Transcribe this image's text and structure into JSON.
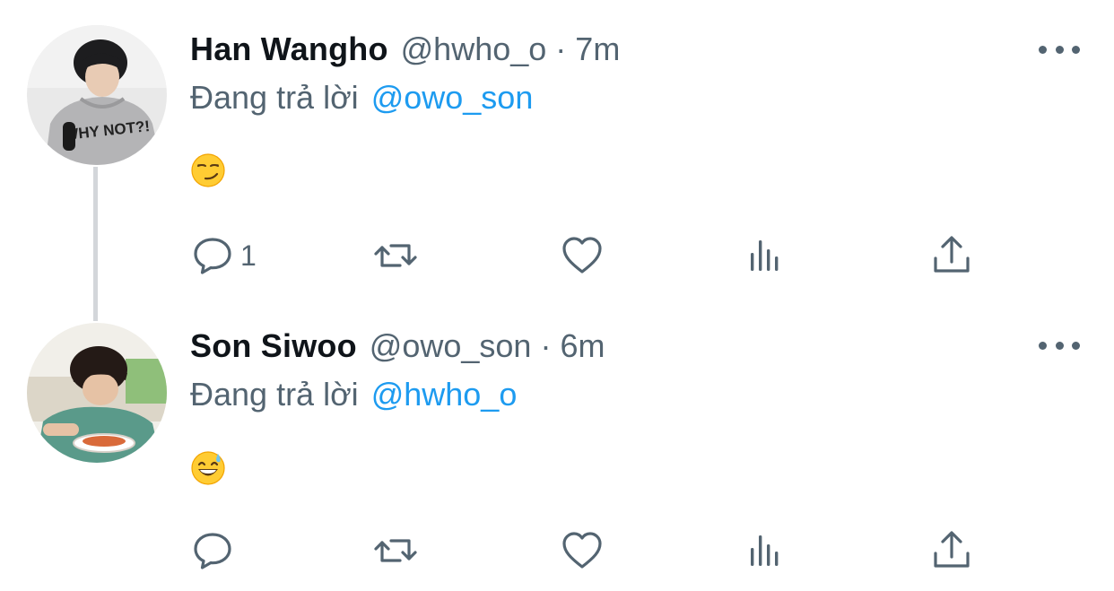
{
  "colors": {
    "name": "#0f1419",
    "secondary": "#536471",
    "mention": "#1d9bf0",
    "thread_line": "#d3d6da"
  },
  "tweets": [
    {
      "name": "Han Wangho",
      "handle": "@hwho_o",
      "separator": "·",
      "time": "7m",
      "reply_prefix": "Đang trả lời",
      "reply_to": "@owo_son",
      "emoji": "smirking-face",
      "avatar": "profile photo",
      "actions": {
        "reply_count": "1",
        "retweet_count": "",
        "like_count": ""
      }
    },
    {
      "name": "Son Siwoo",
      "handle": "@owo_son",
      "separator": "·",
      "time": "6m",
      "reply_prefix": "Đang trả lời",
      "reply_to": "@hwho_o",
      "emoji": "grinning-face-with-sweat",
      "avatar": "profile photo",
      "actions": {
        "reply_count": "",
        "retweet_count": "",
        "like_count": ""
      }
    }
  ],
  "icons": [
    "reply-icon",
    "retweet-icon",
    "like-icon",
    "views-icon",
    "share-icon",
    "more-icon"
  ]
}
